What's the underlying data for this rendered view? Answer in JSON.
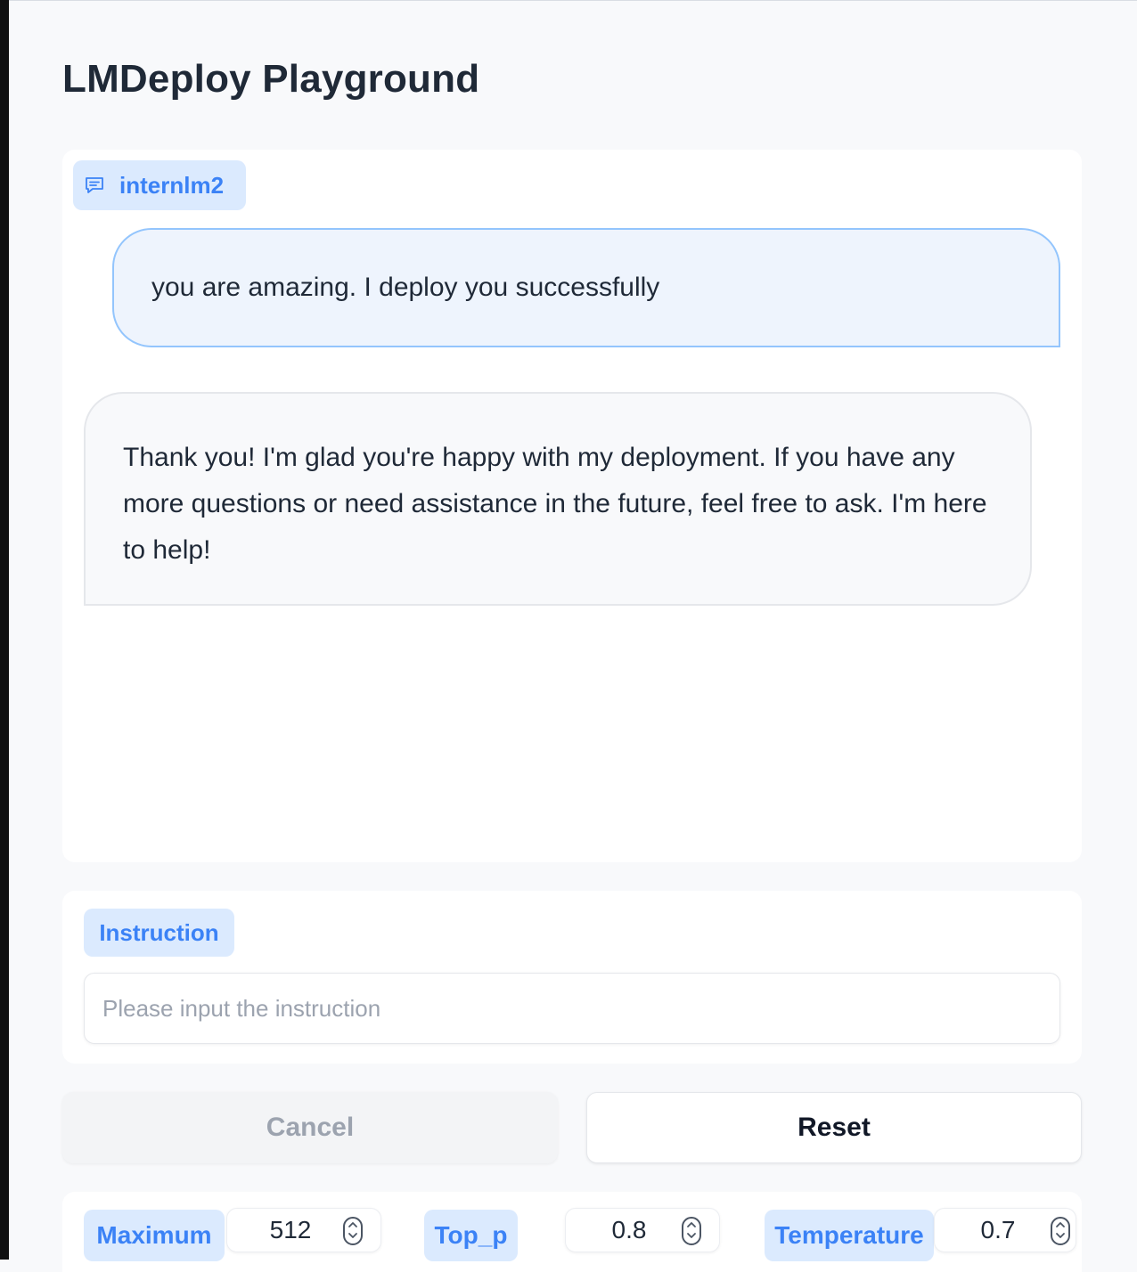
{
  "app": {
    "title": "LMDeploy Playground"
  },
  "chat": {
    "label": "internlm2",
    "messages": [
      {
        "role": "user",
        "text": "you are amazing. I deploy you successfully"
      },
      {
        "role": "assistant",
        "text": "Thank you! I'm glad you're happy with my deployment. If you have any more questions or need assistance in the future, feel free to ask. I'm here to help!"
      }
    ]
  },
  "instruction": {
    "label": "Instruction",
    "placeholder": "Please input the instruction",
    "value": ""
  },
  "buttons": {
    "cancel": "Cancel",
    "reset": "Reset"
  },
  "params": [
    {
      "label": "Maximum",
      "value": "512"
    },
    {
      "label": "Top_p",
      "value": "0.8"
    },
    {
      "label": "Temperature",
      "value": "0.7"
    }
  ],
  "colors": {
    "accent": "#3b82f6",
    "label_bg": "#dbeafe",
    "user_bubble_bg": "#eef4fd",
    "user_bubble_border": "#93c5fd",
    "bot_bubble_bg": "#f8f9fb"
  },
  "icons": {
    "chat_label": "chat-bubble-icon",
    "spinner": "up-down-chevron-icon"
  }
}
